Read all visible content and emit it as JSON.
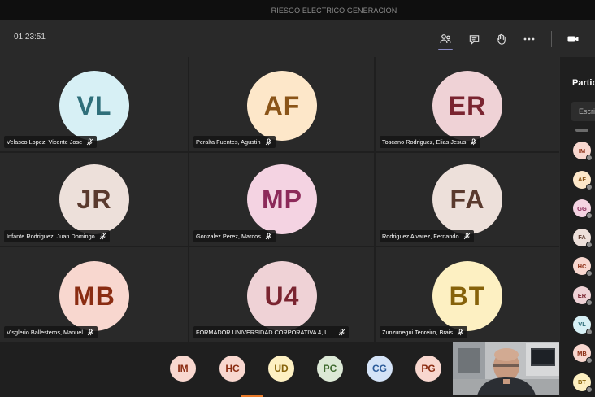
{
  "window": {
    "title": "RIESGO ELECTRICO GENERACION"
  },
  "toolbar": {
    "timer": "01:23:51",
    "buttons": [
      {
        "name": "participants-icon",
        "active": true
      },
      {
        "name": "chat-icon"
      },
      {
        "name": "raise-hand-icon"
      },
      {
        "name": "more-options-icon"
      },
      {
        "name": "camera-icon"
      }
    ]
  },
  "grid": {
    "tiles": [
      {
        "initials": "VL",
        "name": "Velasco Lopez, Vicente Jose",
        "bg": "#d7f0f5",
        "fg": "#2f6f7a"
      },
      {
        "initials": "AF",
        "name": "Peralta Fuentes, Agustin",
        "bg": "#fde7c9",
        "fg": "#8a5417"
      },
      {
        "initials": "ER",
        "name": "Toscano Rodriguez, Elias Jesus",
        "bg": "#efd2d6",
        "fg": "#7a2430"
      },
      {
        "initials": "JR",
        "name": "Infante Rodriguez, Juan Domingo",
        "bg": "#ede0da",
        "fg": "#5a3a2e"
      },
      {
        "initials": "MP",
        "name": "Gonzalez Perez, Marcos",
        "bg": "#f4d3e2",
        "fg": "#8c2a5a"
      },
      {
        "initials": "FA",
        "name": "Rodriguez Alvarez, Fernando",
        "bg": "#ede0da",
        "fg": "#5a3a2e"
      },
      {
        "initials": "MB",
        "name": "Visglerio Ballesteros, Manuel",
        "bg": "#f8d7cf",
        "fg": "#8a2c12"
      },
      {
        "initials": "U4",
        "name": "FORMADOR UNIVERSIDAD CORPORATIVA 4, U...",
        "bg": "#efd2d6",
        "fg": "#7a2430"
      },
      {
        "initials": "BT",
        "name": "Zunzunegui Tenreiro, Brais",
        "bg": "#fdf0c2",
        "fg": "#86620a"
      }
    ]
  },
  "strip": {
    "avatars": [
      {
        "initials": "IM",
        "bg": "#f8d7cf",
        "fg": "#8a2c12"
      },
      {
        "initials": "HC",
        "bg": "#f8d7cf",
        "fg": "#8a2c12"
      },
      {
        "initials": "UD",
        "bg": "#fdf0c2",
        "fg": "#86620a"
      },
      {
        "initials": "PC",
        "bg": "#dce9d6",
        "fg": "#3e6a2f"
      },
      {
        "initials": "CG",
        "bg": "#d4e3f7",
        "fg": "#2d5c9a"
      },
      {
        "initials": "PG",
        "bg": "#f8d7cf",
        "fg": "#8a2c12"
      }
    ]
  },
  "panel": {
    "title": "Participantes",
    "search_placeholder": "Escribe un nombre",
    "items": [
      {
        "initials": "IM",
        "bg": "#f8d7cf",
        "fg": "#8a2c12"
      },
      {
        "initials": "AF",
        "bg": "#fde7c9",
        "fg": "#8a5417"
      },
      {
        "initials": "GG",
        "bg": "#f4d3e2",
        "fg": "#8c2a5a"
      },
      {
        "initials": "FA",
        "bg": "#ede0da",
        "fg": "#5a3a2e"
      },
      {
        "initials": "HC",
        "bg": "#f8d7cf",
        "fg": "#8a2c12"
      },
      {
        "initials": "ER",
        "bg": "#efd2d6",
        "fg": "#7a2430"
      },
      {
        "initials": "VL",
        "bg": "#d7f0f5",
        "fg": "#2f6f7a"
      },
      {
        "initials": "MB",
        "bg": "#f8d7cf",
        "fg": "#8a2c12"
      },
      {
        "initials": "BT",
        "bg": "#fdf0c2",
        "fg": "#86620a"
      }
    ]
  }
}
